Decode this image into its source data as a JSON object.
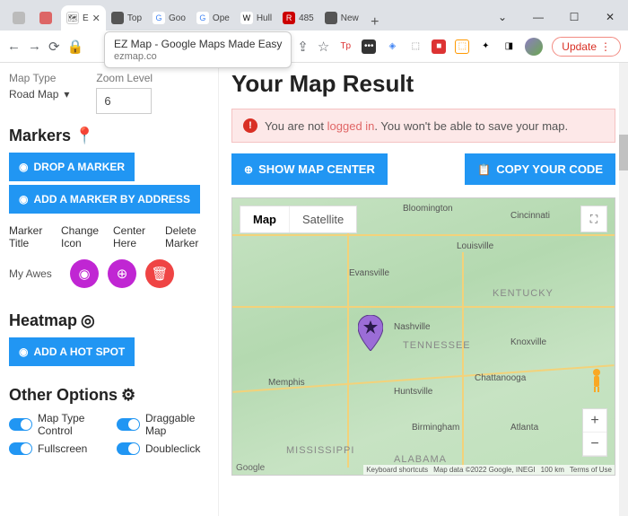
{
  "window": {
    "tabs": [
      {
        "label": "",
        "fav": ""
      },
      {
        "label": "",
        "fav": ""
      },
      {
        "label": "E",
        "fav": "🗺",
        "active": true
      },
      {
        "label": "Top",
        "fav": "◎"
      },
      {
        "label": "Goo",
        "fav": "G"
      },
      {
        "label": "Ope",
        "fav": "G"
      },
      {
        "label": "Hull",
        "fav": "W"
      },
      {
        "label": "485",
        "fav": "R"
      },
      {
        "label": "New",
        "fav": "◔"
      }
    ],
    "newtab": "+",
    "controls": {
      "chev": "⌄",
      "min": "—",
      "max": "☐",
      "close": "✕"
    }
  },
  "toolbar": {
    "back": "←",
    "fwd": "→",
    "reload": "⟳",
    "lock": "🔒",
    "share": "⇪",
    "star": "☆",
    "update": "Update",
    "menu": "⋮"
  },
  "tooltip": {
    "title": "EZ Map - Google Maps Made Easy",
    "sub": "ezmap.co"
  },
  "sidebar": {
    "maptype": {
      "label": "Map Type",
      "value": "Road Map"
    },
    "zoom": {
      "label": "Zoom Level",
      "value": "6"
    },
    "markers": {
      "title": "Markers",
      "drop": "DROP A MARKER",
      "addaddr": "ADD A MARKER BY ADDRESS",
      "cols": {
        "c1": "Marker Title",
        "c2": "Change Icon",
        "c3": "Center Here",
        "c4": "Delete Marker"
      },
      "row": {
        "name": "My Awes"
      }
    },
    "heatmap": {
      "title": "Heatmap",
      "btn": "ADD A HOT SPOT"
    },
    "other": {
      "title": "Other Options",
      "o1": "Map Type Control",
      "o2": "Draggable Map",
      "o3": "Fullscreen",
      "o4": "Doubleclick"
    }
  },
  "content": {
    "title": "Your Map Result",
    "alert": {
      "pre": "You are not ",
      "link": "logged in",
      "post": ". You won't be able to save your map."
    },
    "actions": {
      "center": "SHOW MAP CENTER",
      "copy": "COPY YOUR CODE"
    },
    "map": {
      "views": {
        "map": "Map",
        "sat": "Satellite"
      },
      "zoom": {
        "in": "+",
        "out": "−"
      },
      "cities": {
        "bloom": "Bloomington",
        "cinc": "Cincinnati",
        "louis": "Louisville",
        "evans": "Evansville",
        "nash": "Nashville",
        "knox": "Knoxville",
        "memph": "Memphis",
        "hunts": "Huntsville",
        "chatt": "Chattanooga",
        "birm": "Birmingham",
        "atl": "Atlanta"
      },
      "states": {
        "ky": "KENTUCKY",
        "tn": "TENNESSEE",
        "ms": "MISSISSIPPI",
        "al": "ALABAMA"
      },
      "attrib": {
        "kb": "Keyboard shortcuts",
        "data": "Map data ©2022 Google, INEGI",
        "scale": "100 km",
        "terms": "Terms of Use"
      },
      "logo": "Google"
    }
  }
}
